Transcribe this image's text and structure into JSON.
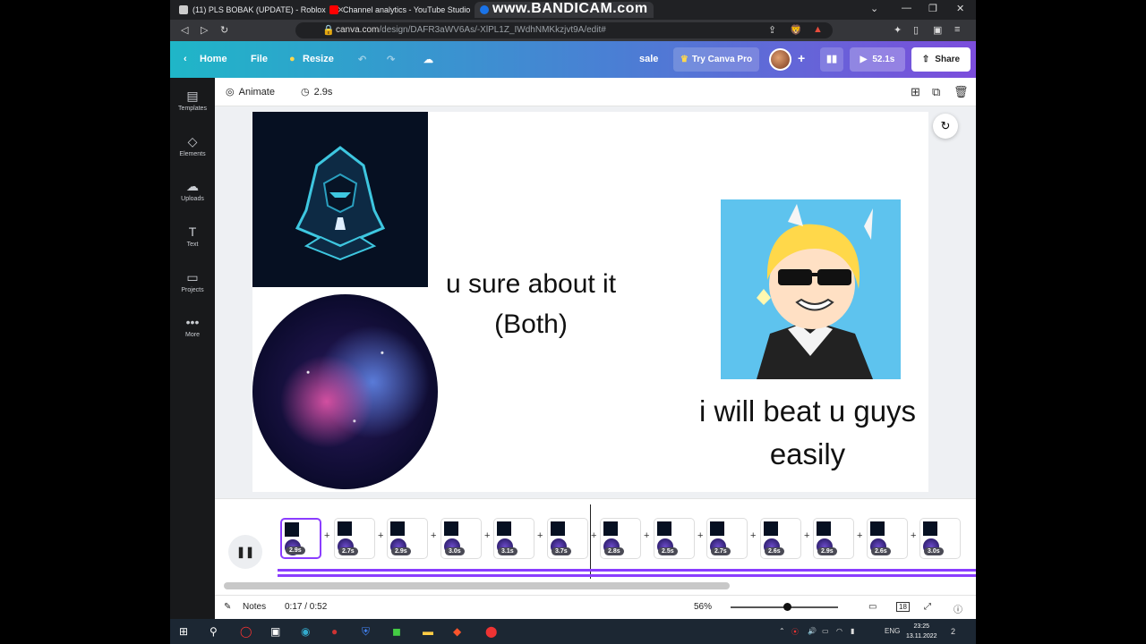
{
  "browser": {
    "tabs": [
      {
        "title": "(11) PLS BOBAK (UPDATE) - Roblox",
        "favicon_color": "#cccccc"
      },
      {
        "title": "Channel analytics - YouTube Studio",
        "favicon_color": "#ff0000"
      },
      {
        "title": "www.BANDICAM.com",
        "favicon_color": "#1a73e8"
      }
    ],
    "url_host": "canva.com",
    "url_path": "/design/DAFR3aWV6As/-XlPL1Z_IWdhNMKkzjvt9A/edit#"
  },
  "canva_header": {
    "home": "Home",
    "file": "File",
    "resize": "Resize",
    "sale": "sale",
    "try_pro": "Try Canva Pro",
    "present_time": "52.1s",
    "share": "Share"
  },
  "sidebar": {
    "items": [
      {
        "label": "Templates",
        "icon": "layout-icon"
      },
      {
        "label": "Elements",
        "icon": "shapes-icon"
      },
      {
        "label": "Uploads",
        "icon": "cloud-upload-icon"
      },
      {
        "label": "Text",
        "icon": "text-icon"
      },
      {
        "label": "Projects",
        "icon": "folder-icon"
      },
      {
        "label": "More",
        "icon": "more-icon"
      }
    ]
  },
  "toolbar": {
    "animate": "Animate",
    "duration": "2.9s"
  },
  "canvas": {
    "text_left_line1": "u sure about it",
    "text_left_line2": "(Both)",
    "text_right_line1": "i will beat u guys",
    "text_right_line2": "easily"
  },
  "timeline": {
    "pages": [
      {
        "duration": "2.9s",
        "active": true
      },
      {
        "duration": "2.7s"
      },
      {
        "duration": "2.9s"
      },
      {
        "duration": "3.0s"
      },
      {
        "duration": "3.1s"
      },
      {
        "duration": "3.7s"
      },
      {
        "duration": "2.8s"
      },
      {
        "duration": "2.5s"
      },
      {
        "duration": "2.7s"
      },
      {
        "duration": "2.6s"
      },
      {
        "duration": "2.9s"
      },
      {
        "duration": "2.6s"
      },
      {
        "duration": "3.0s"
      }
    ]
  },
  "footer": {
    "notes": "Notes",
    "time": "0:17 / 0:52",
    "zoom": "56%",
    "page_count": "18",
    "zoom_level": 0.56
  },
  "taskbar": {
    "lang": "ENG",
    "time": "23:25",
    "date": "13.11.2022",
    "notifications": "2"
  },
  "colors": {
    "accent": "#8b3dff",
    "header_start": "#1fb6c8",
    "header_end": "#7c4ddc"
  }
}
